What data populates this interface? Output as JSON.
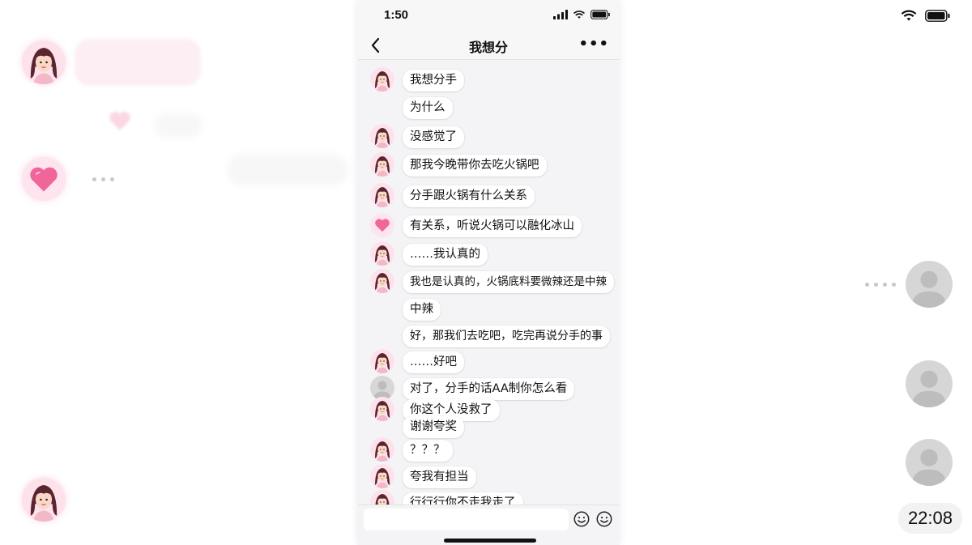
{
  "background": {
    "time_badge": "22:08"
  },
  "phone": {
    "status_time": "1:50",
    "title": "我想分",
    "messages": [
      {
        "avatar": "girl-avatar",
        "text": "我想分手"
      },
      {
        "avatar": "none",
        "text": "为什么"
      },
      {
        "avatar": "girl-avatar",
        "text": "没感觉了"
      },
      {
        "avatar": "girl-avatar",
        "text": "那我今晚带你去吃火锅吧"
      },
      {
        "avatar": "girl-avatar",
        "text": "分手跟火锅有什么关系"
      },
      {
        "avatar": "heart-avatar",
        "text": "有关系，听说火锅可以融化冰山"
      },
      {
        "avatar": "girl-avatar",
        "text": "……我认真的"
      },
      {
        "avatar": "girl-avatar",
        "text": "我也是认真的，火锅底料要微辣还是中辣"
      },
      {
        "avatar": "none",
        "text": "中辣"
      },
      {
        "avatar": "none",
        "text": "好，那我们去吃吧，吃完再说分手的事"
      },
      {
        "avatar": "girl-avatar",
        "text": "……好吧"
      },
      {
        "avatar": "gray-avatar",
        "text": "对了，分手的话AA制你怎么看"
      },
      {
        "avatar": "girl-avatar",
        "text": "你这个人没救了"
      },
      {
        "avatar": "none",
        "text": "谢谢夸奖"
      },
      {
        "avatar": "girl-avatar",
        "text": "？？？"
      },
      {
        "avatar": "girl-avatar",
        "text": "夸我有担当"
      },
      {
        "avatar": "girl-avatar",
        "text": "行行行你不走我走了"
      }
    ],
    "input_placeholder": ""
  },
  "colors": {
    "page_bg": "#ffffff",
    "phone_bg": "#f4f4f6",
    "bubble_bg": "#ffffff",
    "avatar_pink": "#fde6ee",
    "heart": "#f0669a"
  }
}
